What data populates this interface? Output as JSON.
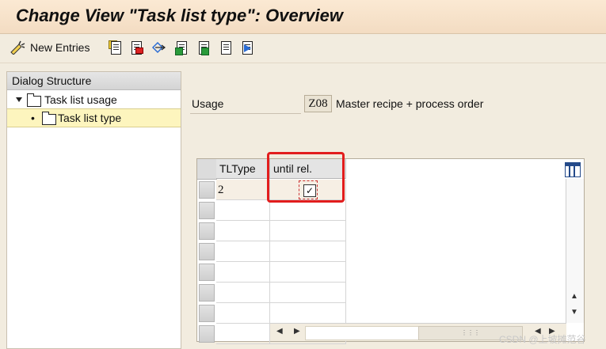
{
  "window": {
    "title": "Change View \"Task list type\": Overview"
  },
  "toolbar": {
    "new_entries_label": "New Entries",
    "icons": [
      "new-entries-icon",
      "copy-as-icon",
      "delete-icon",
      "undo-change-icon",
      "select-all-icon",
      "select-block-icon",
      "deselect-all-icon",
      "choose-icon"
    ]
  },
  "dialog_structure": {
    "header": "Dialog Structure",
    "items": [
      {
        "label": "Task list usage",
        "level": 0,
        "expanded": true,
        "selected": false
      },
      {
        "label": "Task list type",
        "level": 1,
        "expanded": false,
        "selected": true
      }
    ]
  },
  "usage": {
    "label": "Usage",
    "value": "Z08",
    "description": "Master recipe + process order"
  },
  "table": {
    "columns": [
      "TLType",
      "until rel."
    ],
    "rows": [
      {
        "tltype": "2",
        "until_rel": true
      },
      {
        "tltype": "",
        "until_rel": null
      },
      {
        "tltype": "",
        "until_rel": null
      },
      {
        "tltype": "",
        "until_rel": null
      },
      {
        "tltype": "",
        "until_rel": null
      },
      {
        "tltype": "",
        "until_rel": null
      },
      {
        "tltype": "",
        "until_rel": null
      },
      {
        "tltype": "",
        "until_rel": null
      }
    ],
    "checkbox_mark": "✓"
  },
  "watermark": "CSDN @上坡摊范谷",
  "colors": {
    "title_bar": "#f3dcc2",
    "background": "#f2ecdf",
    "tree_selected": "#fdf5be",
    "highlight_box": "#e21d1d"
  }
}
